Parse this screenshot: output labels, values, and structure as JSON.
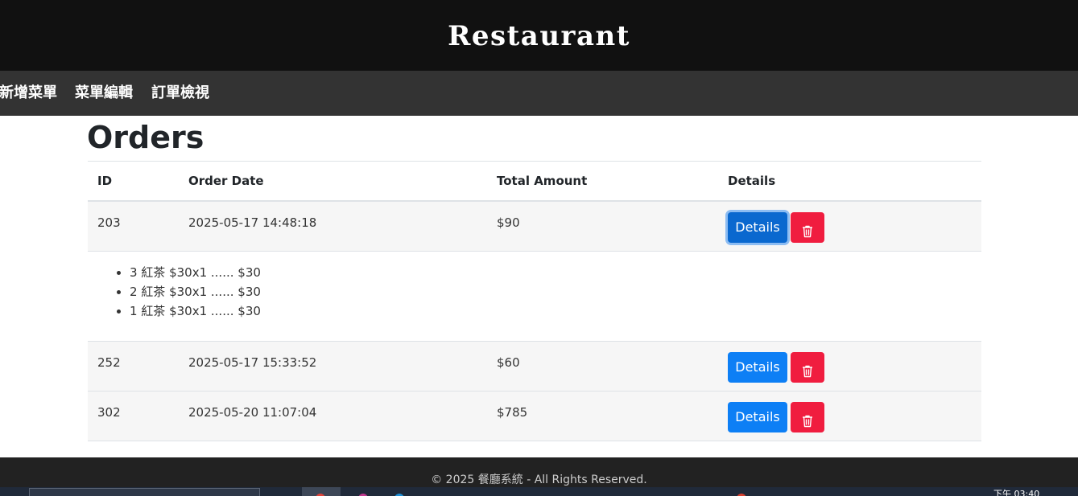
{
  "header": {
    "title": "Restaurant"
  },
  "nav": {
    "items": [
      {
        "label": "新增菜單"
      },
      {
        "label": "菜單編輯"
      },
      {
        "label": "訂單檢視"
      }
    ]
  },
  "page": {
    "title": "Orders"
  },
  "table": {
    "columns": [
      "ID",
      "Order Date",
      "Total Amount",
      "Details"
    ],
    "orders": [
      {
        "id": "203",
        "date": "2025-05-17 14:48:18",
        "total": "$90",
        "details_label": "Details",
        "expanded": true,
        "items": [
          "3 紅茶 $30x1 ...... $30",
          "2 紅茶 $30x1 ...... $30",
          "1 紅茶 $30x1 ...... $30"
        ]
      },
      {
        "id": "252",
        "date": "2025-05-17 15:33:52",
        "total": "$60",
        "details_label": "Details"
      },
      {
        "id": "302",
        "date": "2025-05-20 11:07:04",
        "total": "$785",
        "details_label": "Details"
      }
    ],
    "delete_icon": "trash-icon"
  },
  "footer": {
    "text": "© 2025 餐廳系統 - All Rights Reserved."
  },
  "taskbar": {
    "clock": "下午 03:40"
  },
  "colors": {
    "header_bg": "#111111",
    "nav_bg": "#333333",
    "details_button": "#0d7ff5",
    "delete_button": "#f01d3f",
    "footer_bg": "#222222"
  }
}
